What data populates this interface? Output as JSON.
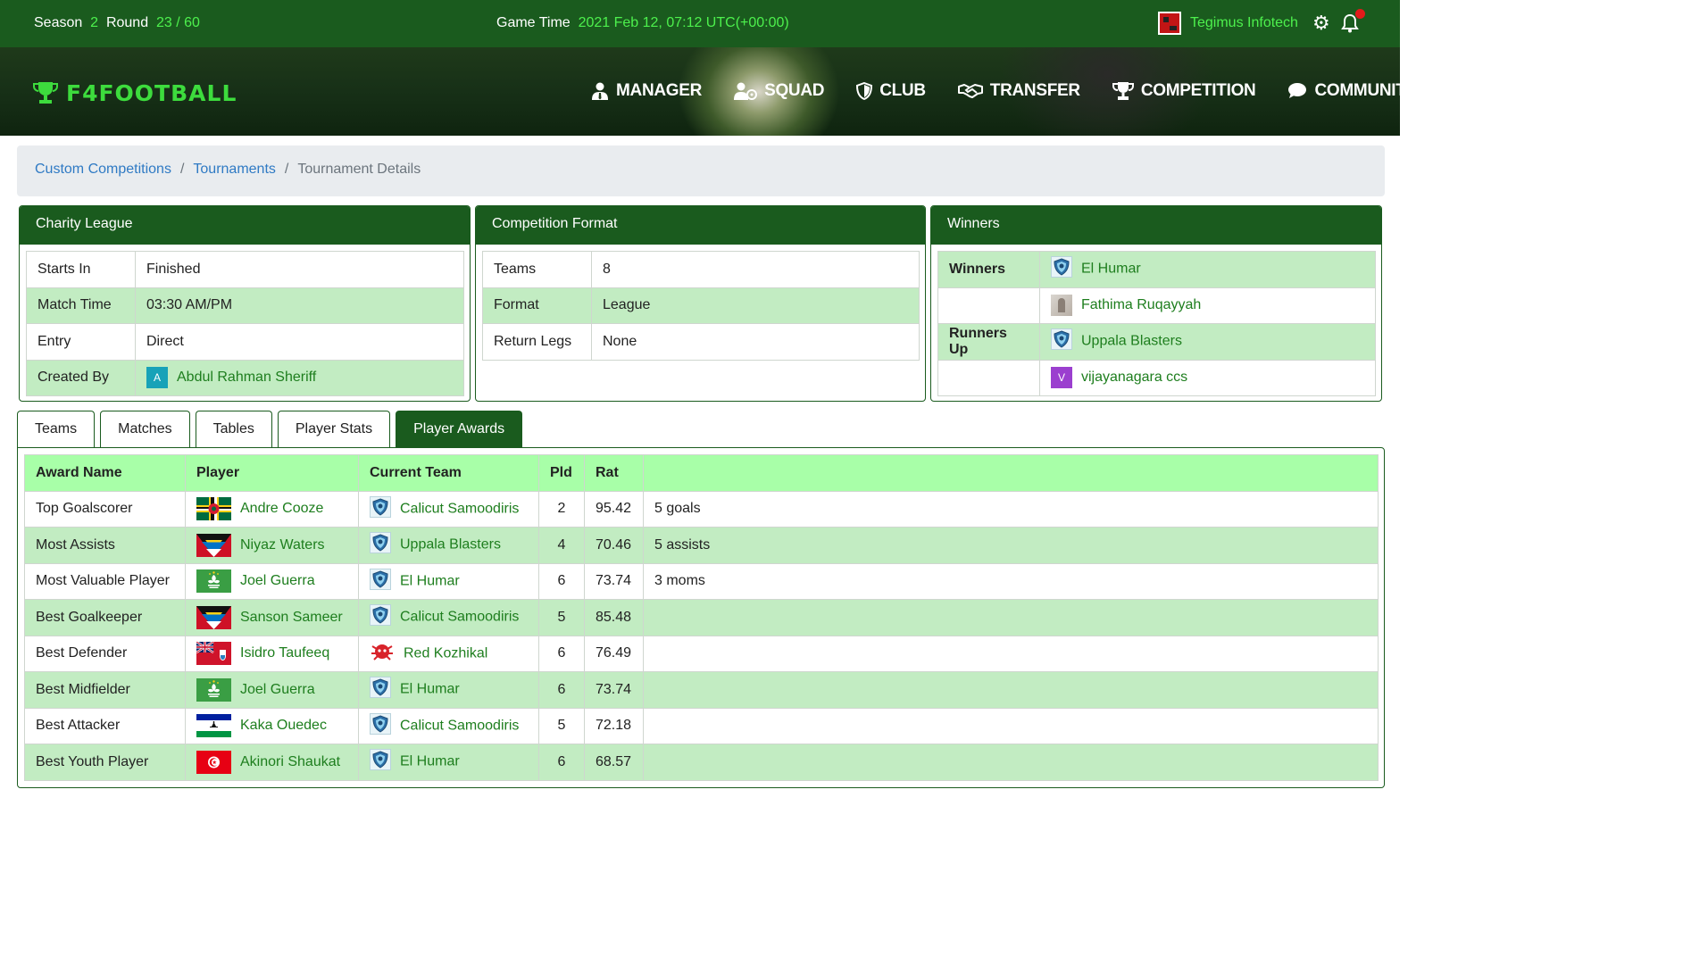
{
  "topbar": {
    "season_label": "Season",
    "season_value": "2",
    "round_label": "Round",
    "round_value": "23 / 60",
    "game_time_label": "Game Time",
    "game_time_value": "2021 Feb 12, 07:12 UTC(+00:00)",
    "company": "Tegimus Infotech",
    "settings_icon": "gear-icon",
    "notification_icon": "bell-icon"
  },
  "brand": {
    "name": "F4FOOTBALL"
  },
  "nav": [
    {
      "label": "MANAGER",
      "icon": "manager-icon"
    },
    {
      "label": "SQUAD",
      "icon": "squad-icon"
    },
    {
      "label": "CLUB",
      "icon": "shield-icon"
    },
    {
      "label": "TRANSFER",
      "icon": "handshake-icon"
    },
    {
      "label": "COMPETITION",
      "icon": "trophy-icon"
    },
    {
      "label": "COMMUNITY",
      "icon": "chat-icon"
    }
  ],
  "breadcrumb": {
    "items": [
      "Custom Competitions",
      "Tournaments"
    ],
    "separator": "/",
    "current": "Tournament Details"
  },
  "league_panel": {
    "title": "Charity League",
    "rows": [
      {
        "label": "Starts In",
        "value": "Finished"
      },
      {
        "label": "Match Time",
        "value": "03:30 AM/PM"
      },
      {
        "label": "Entry",
        "value": "Direct"
      },
      {
        "label": "Created By",
        "value": "Abdul Rahman Sheriff",
        "avatar": "A"
      }
    ]
  },
  "format_panel": {
    "title": "Competition Format",
    "rows": [
      {
        "label": "Teams",
        "value": "8"
      },
      {
        "label": "Format",
        "value": "League"
      },
      {
        "label": "Return Legs",
        "value": "None"
      }
    ]
  },
  "winners_panel": {
    "title": "Winners",
    "winners_label": "Winners",
    "winner_team": "El Humar",
    "winner_manager": "Fathima Ruqayyah",
    "runners_label": "Runners Up",
    "runner_team": "Uppala Blasters",
    "runner_manager": "vijayanagara ccs",
    "runner_manager_avatar": "V"
  },
  "tabs": [
    "Teams",
    "Matches",
    "Tables",
    "Player Stats",
    "Player Awards"
  ],
  "active_tab": "Player Awards",
  "awards": {
    "columns": [
      "Award Name",
      "Player",
      "Current Team",
      "Pld",
      "Rat",
      ""
    ],
    "rows": [
      {
        "award": "Top Goalscorer",
        "player": "Andre Cooze",
        "flag": "dominica",
        "team": "Calicut Samoodiris",
        "pld": "2",
        "rat": "95.42",
        "note": "5 goals"
      },
      {
        "award": "Most Assists",
        "player": "Niyaz Waters",
        "flag": "antigua",
        "team": "Uppala Blasters",
        "pld": "4",
        "rat": "70.46",
        "note": "5 assists"
      },
      {
        "award": "Most Valuable Player",
        "player": "Joel Guerra",
        "flag": "macau",
        "team": "El Humar",
        "pld": "6",
        "rat": "73.74",
        "note": "3 moms"
      },
      {
        "award": "Best Goalkeeper",
        "player": "Sanson Sameer",
        "flag": "antigua",
        "team": "Calicut Samoodiris",
        "pld": "5",
        "rat": "85.48",
        "note": ""
      },
      {
        "award": "Best Defender",
        "player": "Isidro Taufeeq",
        "flag": "bermuda",
        "team": "Red Kozhikal",
        "pld": "6",
        "rat": "76.49",
        "note": ""
      },
      {
        "award": "Best Midfielder",
        "player": "Joel Guerra",
        "flag": "macau",
        "team": "El Humar",
        "pld": "6",
        "rat": "73.74",
        "note": ""
      },
      {
        "award": "Best Attacker",
        "player": "Kaka Ouedec",
        "flag": "lesotho",
        "team": "Calicut Samoodiris",
        "pld": "5",
        "rat": "72.18",
        "note": ""
      },
      {
        "award": "Best Youth Player",
        "player": "Akinori Shaukat",
        "flag": "tunisia",
        "team": "El Humar",
        "pld": "6",
        "rat": "68.57",
        "note": ""
      }
    ]
  },
  "colors": {
    "primary_green": "#1a5b1e",
    "accent_green": "#4df04d",
    "header_row": "#a8ffa8",
    "alt_row": "#c2ecc2",
    "link_green": "#1e7e1e",
    "link_blue": "#2f7ac4"
  }
}
